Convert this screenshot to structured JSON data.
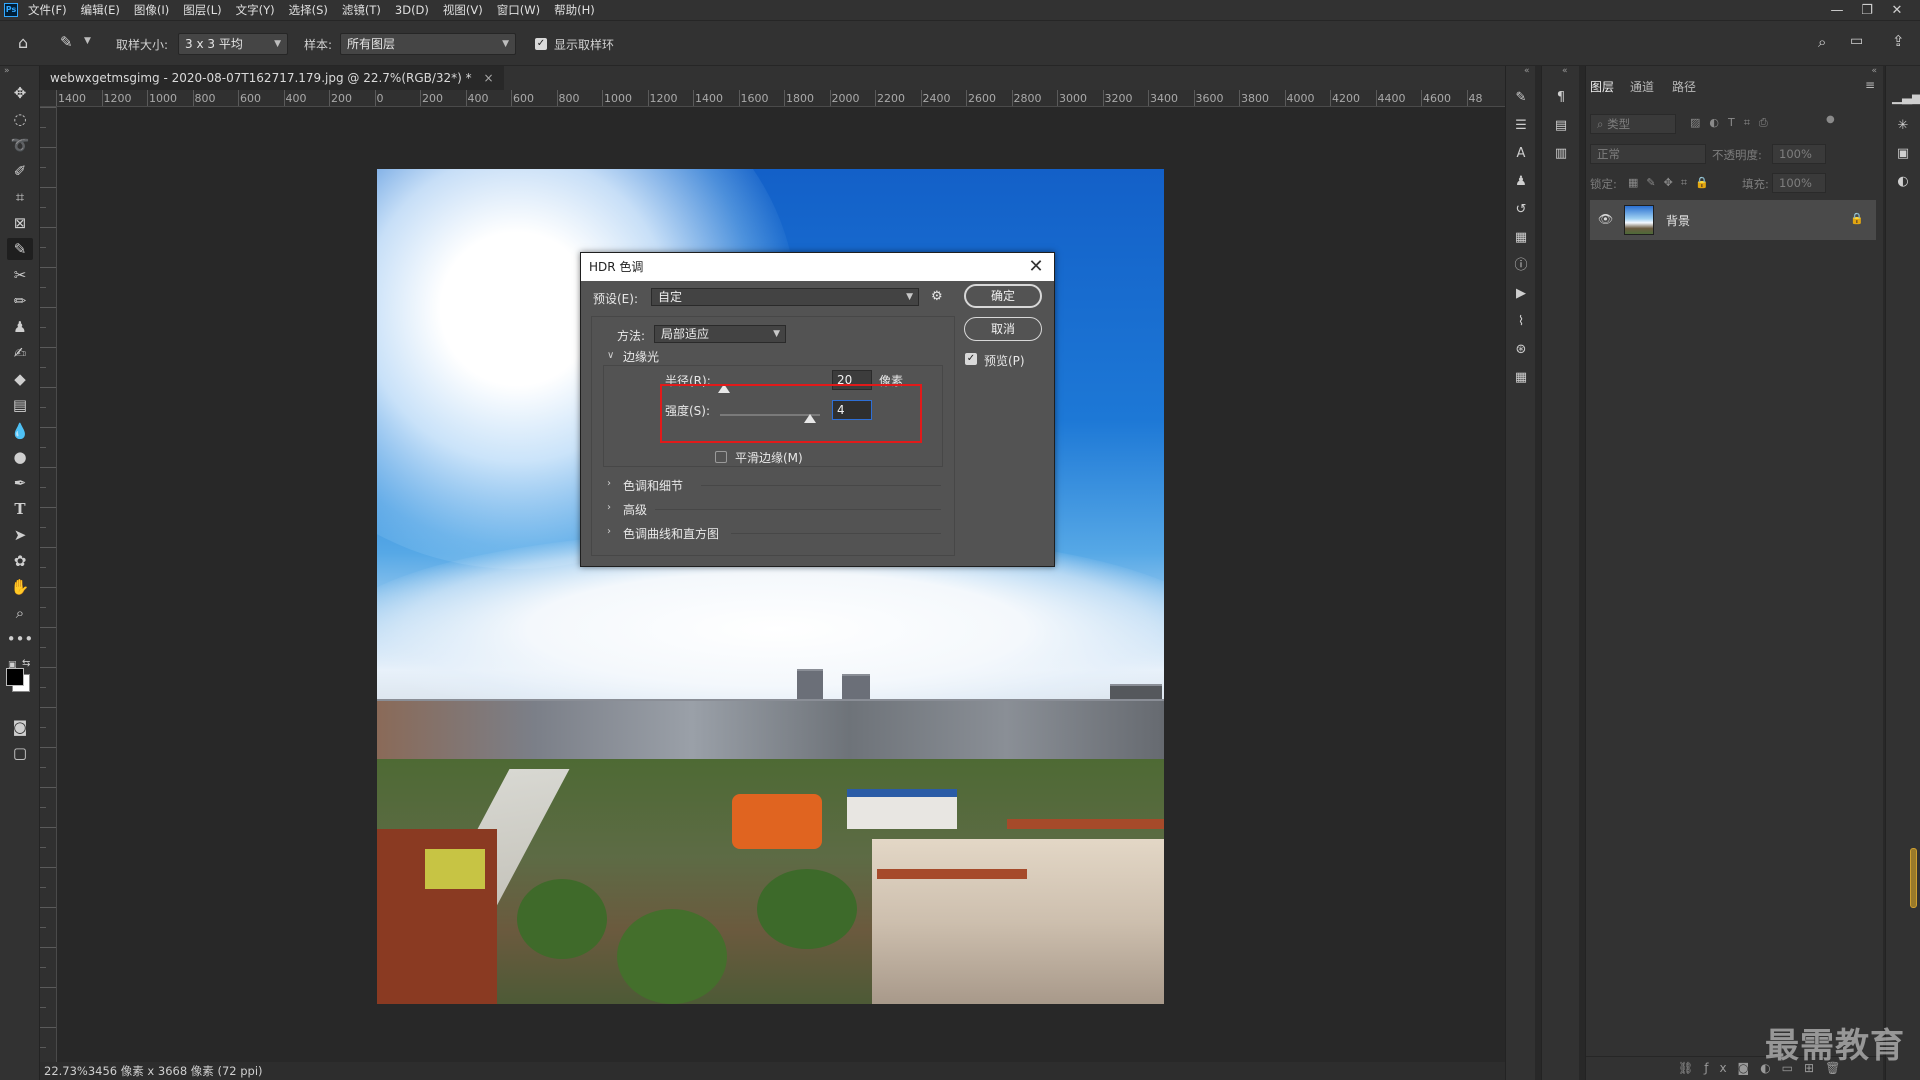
{
  "menubar": {
    "logo": "Ps",
    "items": [
      "文件(F)",
      "编辑(E)",
      "图像(I)",
      "图层(L)",
      "文字(Y)",
      "选择(S)",
      "滤镜(T)",
      "3D(D)",
      "视图(V)",
      "窗口(W)",
      "帮助(H)"
    ]
  },
  "options_bar": {
    "sample_size_label": "取样大小:",
    "sample_size_value": "3 x 3 平均",
    "sample_label": "样本:",
    "sample_value": "所有图层",
    "show_ring_label": "显示取样环",
    "show_ring_checked": true
  },
  "document": {
    "tab_title": "webwxgetmsgimg - 2020-08-07T162717.179.jpg @ 22.7%(RGB/32*) *",
    "tab_close": "×",
    "ruler_h": [
      "1400",
      "1200",
      "1000",
      "800",
      "600",
      "400",
      "200",
      "0",
      "200",
      "400",
      "600",
      "800",
      "1000",
      "1200",
      "1400",
      "1600",
      "1800",
      "2000",
      "2200",
      "2400",
      "2600",
      "2800",
      "3000",
      "3200",
      "3400",
      "3600",
      "3800",
      "4000",
      "4200",
      "4400",
      "4600",
      "48"
    ],
    "status": "22.73%3456 像素 x 3668 像素 (72 ppi)"
  },
  "dialog": {
    "title": "HDR 色调",
    "preset_label": "预设(E):",
    "preset_value": "自定",
    "ok_label": "确定",
    "cancel_label": "取消",
    "preview_label": "预览(P)",
    "preview_checked": true,
    "method_label": "方法:",
    "method_value": "局部适应",
    "edge_glow_label": "边缘光",
    "radius_label": "半径(R):",
    "radius_value": "20",
    "radius_unit": "像素",
    "radius_slider_fraction": 0.04,
    "strength_label": "强度(S):",
    "strength_value": "4",
    "strength_slider_fraction": 0.9,
    "smooth_edges_label": "平滑边缘(M)",
    "smooth_edges_checked": false,
    "sections": [
      "色调和细节",
      "高级",
      "色调曲线和直方图"
    ]
  },
  "layers_panel": {
    "tabs": [
      "图层",
      "通道",
      "路径"
    ],
    "filter_placeholder": "类型",
    "blend_mode": "正常",
    "opacity_label": "不透明度:",
    "opacity_value": "100%",
    "lock_label": "锁定:",
    "fill_label": "填充:",
    "fill_value": "100%",
    "layer_name": "背景"
  },
  "watermark": "最需教育",
  "colors": {
    "accent": "#2e6fd6",
    "highlight_box": "#e11a1a"
  }
}
